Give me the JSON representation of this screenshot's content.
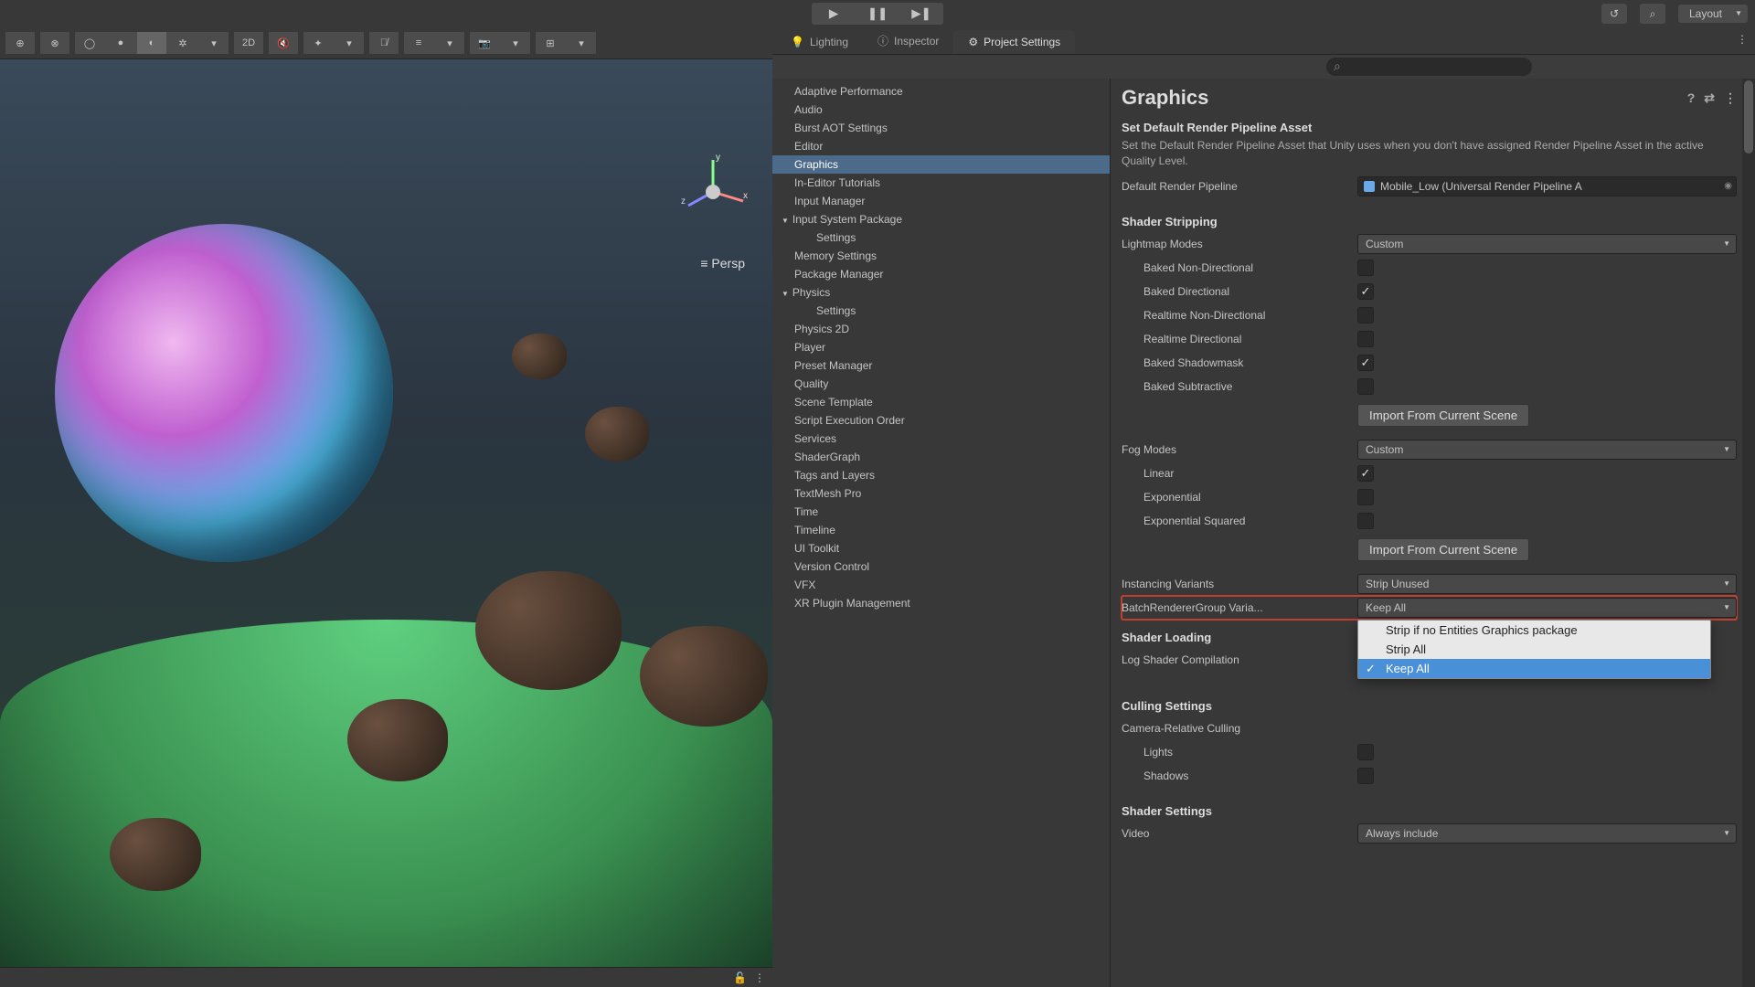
{
  "topbar": {
    "layout_label": "Layout"
  },
  "scene": {
    "persp": "Persp",
    "mode_2d": "2D"
  },
  "tabs": {
    "lighting": "Lighting",
    "inspector": "Inspector",
    "project_settings": "Project Settings"
  },
  "categories": [
    {
      "label": "Adaptive Performance"
    },
    {
      "label": "Audio"
    },
    {
      "label": "Burst AOT Settings"
    },
    {
      "label": "Editor"
    },
    {
      "label": "Graphics",
      "selected": true
    },
    {
      "label": "In-Editor Tutorials"
    },
    {
      "label": "Input Manager"
    },
    {
      "label": "Input System Package",
      "expandable": true
    },
    {
      "label": "Settings",
      "sub": true
    },
    {
      "label": "Memory Settings"
    },
    {
      "label": "Package Manager"
    },
    {
      "label": "Physics",
      "expandable": true
    },
    {
      "label": "Settings",
      "sub": true
    },
    {
      "label": "Physics 2D"
    },
    {
      "label": "Player"
    },
    {
      "label": "Preset Manager"
    },
    {
      "label": "Quality"
    },
    {
      "label": "Scene Template"
    },
    {
      "label": "Script Execution Order"
    },
    {
      "label": "Services"
    },
    {
      "label": "ShaderGraph"
    },
    {
      "label": "Tags and Layers"
    },
    {
      "label": "TextMesh Pro"
    },
    {
      "label": "Time"
    },
    {
      "label": "Timeline"
    },
    {
      "label": "UI Toolkit"
    },
    {
      "label": "Version Control"
    },
    {
      "label": "VFX"
    },
    {
      "label": "XR Plugin Management"
    }
  ],
  "detail": {
    "title": "Graphics",
    "default_rp_head": "Set Default Render Pipeline Asset",
    "default_rp_desc": "Set the Default Render Pipeline Asset that Unity uses when you don't have assigned Render Pipeline Asset in the active Quality Level.",
    "default_rp_label": "Default Render Pipeline",
    "default_rp_value": "Mobile_Low (Universal Render Pipeline A",
    "shader_stripping": "Shader Stripping",
    "lightmap_modes": "Lightmap Modes",
    "lightmap_modes_value": "Custom",
    "baked_nd": "Baked Non-Directional",
    "baked_d": "Baked Directional",
    "realtime_nd": "Realtime Non-Directional",
    "realtime_d": "Realtime Directional",
    "baked_sm": "Baked Shadowmask",
    "baked_sub": "Baked Subtractive",
    "import_btn": "Import From Current Scene",
    "fog_modes": "Fog Modes",
    "fog_modes_value": "Custom",
    "linear": "Linear",
    "exponential": "Exponential",
    "exp_sq": "Exponential Squared",
    "instancing": "Instancing Variants",
    "instancing_value": "Strip Unused",
    "brg": "BatchRendererGroup Varia...",
    "brg_value": "Keep All",
    "brg_options": [
      "Strip if no Entities Graphics package",
      "Strip All",
      "Keep All"
    ],
    "shader_loading": "Shader Loading",
    "log_shader": "Log Shader Compilation",
    "culling": "Culling Settings",
    "cam_culling": "Camera-Relative Culling",
    "lights": "Lights",
    "shadows": "Shadows",
    "shader_settings": "Shader Settings",
    "video": "Video",
    "video_value": "Always include"
  }
}
